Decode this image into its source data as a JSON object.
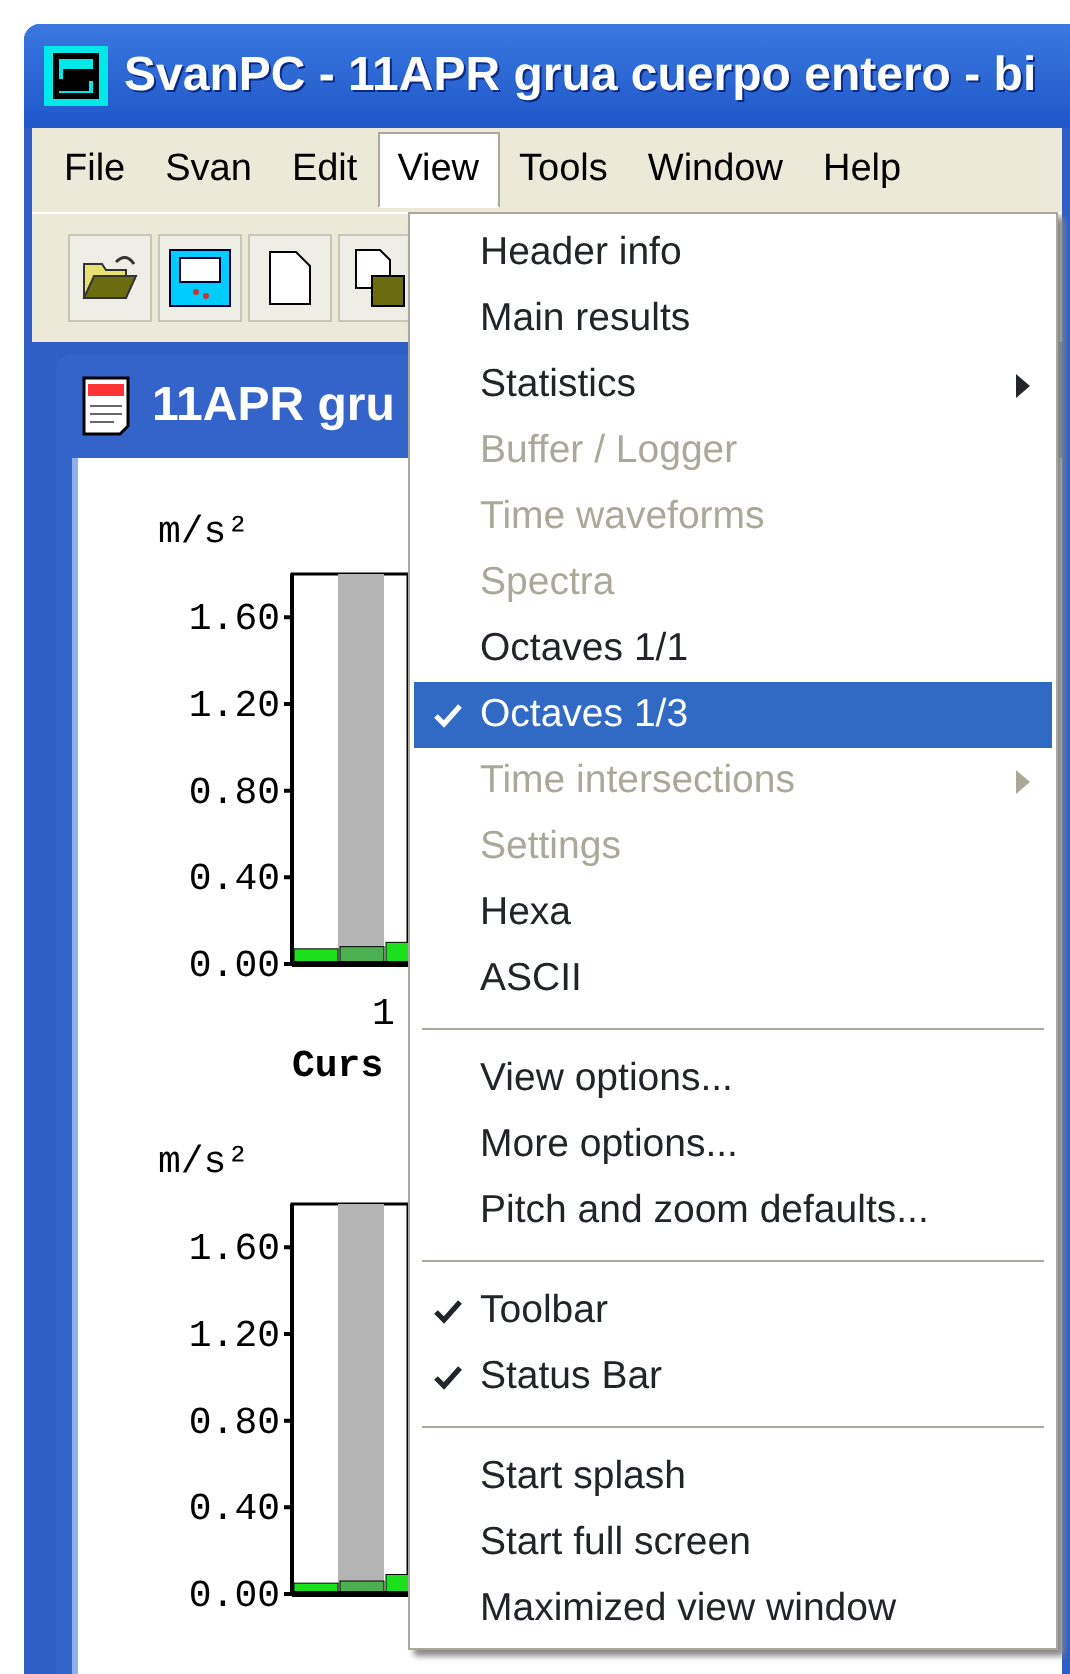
{
  "window": {
    "title": "SvanPC - 11APR grua cuerpo entero - bi"
  },
  "menu_bar": [
    {
      "label": "File",
      "selected": false
    },
    {
      "label": "Svan",
      "selected": false
    },
    {
      "label": "Edit",
      "selected": false
    },
    {
      "label": "View",
      "selected": true
    },
    {
      "label": "Tools",
      "selected": false
    },
    {
      "label": "Window",
      "selected": false
    },
    {
      "label": "Help",
      "selected": false
    }
  ],
  "toolbar": [
    {
      "kind": "open"
    },
    {
      "kind": "device"
    },
    {
      "kind": "new"
    },
    {
      "kind": "save"
    }
  ],
  "document": {
    "title": "11APR gru",
    "charts": [
      {
        "unit": "m/s²",
        "y_tick_labels": [
          "1.60",
          "1.20",
          "0.80",
          "0.40",
          "0.00"
        ],
        "x_label": "1",
        "caption": "Curs"
      },
      {
        "unit": "m/s²",
        "y_tick_labels": [
          "1.60",
          "1.20",
          "0.80",
          "0.40",
          "0.00"
        ]
      }
    ]
  },
  "view_menu": [
    {
      "kind": "item",
      "label": "Header info",
      "enabled": true,
      "checked": false,
      "selected": false,
      "submenu": false
    },
    {
      "kind": "item",
      "label": "Main results",
      "enabled": true,
      "checked": false,
      "selected": false,
      "submenu": false
    },
    {
      "kind": "item",
      "label": "Statistics",
      "enabled": true,
      "checked": false,
      "selected": false,
      "submenu": true
    },
    {
      "kind": "item",
      "label": "Buffer / Logger",
      "enabled": false,
      "checked": false,
      "selected": false,
      "submenu": false
    },
    {
      "kind": "item",
      "label": "Time waveforms",
      "enabled": false,
      "checked": false,
      "selected": false,
      "submenu": false
    },
    {
      "kind": "item",
      "label": "Spectra",
      "enabled": false,
      "checked": false,
      "selected": false,
      "submenu": false
    },
    {
      "kind": "item",
      "label": "Octaves 1/1",
      "enabled": true,
      "checked": false,
      "selected": false,
      "submenu": false
    },
    {
      "kind": "item",
      "label": "Octaves 1/3",
      "enabled": true,
      "checked": true,
      "selected": true,
      "submenu": false
    },
    {
      "kind": "item",
      "label": "Time intersections",
      "enabled": false,
      "checked": false,
      "selected": false,
      "submenu": true
    },
    {
      "kind": "item",
      "label": "Settings",
      "enabled": false,
      "checked": false,
      "selected": false,
      "submenu": false
    },
    {
      "kind": "item",
      "label": "Hexa",
      "enabled": true,
      "checked": false,
      "selected": false,
      "submenu": false
    },
    {
      "kind": "item",
      "label": "ASCII",
      "enabled": true,
      "checked": false,
      "selected": false,
      "submenu": false
    },
    {
      "kind": "separator"
    },
    {
      "kind": "item",
      "label": "View options...",
      "enabled": true,
      "checked": false,
      "selected": false,
      "submenu": false
    },
    {
      "kind": "item",
      "label": "More options...",
      "enabled": true,
      "checked": false,
      "selected": false,
      "submenu": false
    },
    {
      "kind": "item",
      "label": "Pitch and zoom defaults...",
      "enabled": true,
      "checked": false,
      "selected": false,
      "submenu": false
    },
    {
      "kind": "separator"
    },
    {
      "kind": "item",
      "label": "Toolbar",
      "enabled": true,
      "checked": true,
      "selected": false,
      "submenu": false
    },
    {
      "kind": "item",
      "label": "Status Bar",
      "enabled": true,
      "checked": true,
      "selected": false,
      "submenu": false
    },
    {
      "kind": "separator"
    },
    {
      "kind": "item",
      "label": "Start splash",
      "enabled": true,
      "checked": false,
      "selected": false,
      "submenu": false
    },
    {
      "kind": "item",
      "label": "Start full screen",
      "enabled": true,
      "checked": false,
      "selected": false,
      "submenu": false
    },
    {
      "kind": "item",
      "label": "Maximized view window",
      "enabled": true,
      "checked": false,
      "selected": false,
      "submenu": false
    }
  ]
}
